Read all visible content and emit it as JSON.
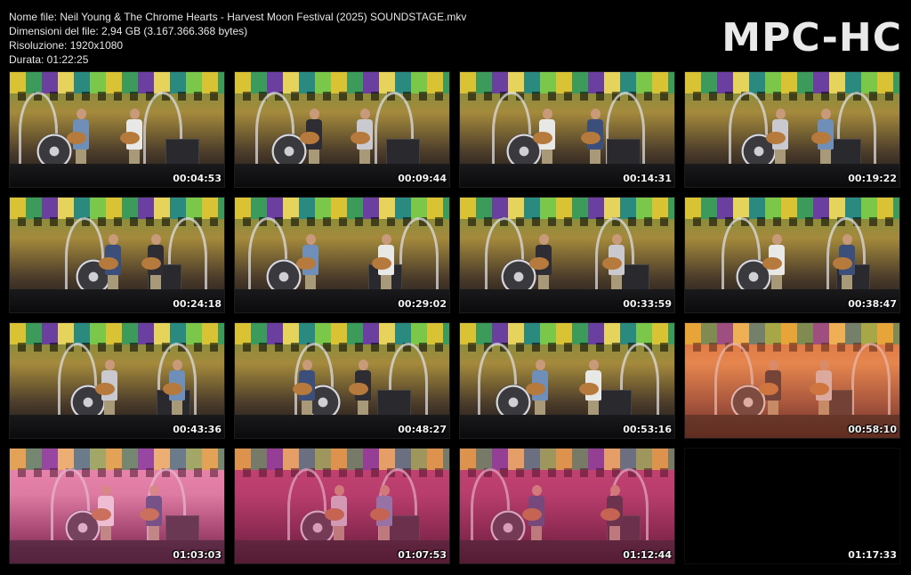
{
  "header": {
    "filename_line": "Nome file: Neil Young & The Chrome Hearts -  Harvest Moon Festival (2025) SOUNDSTAGE.mkv",
    "filesize_line": "Dimensioni del file: 2,94 GB (3.167.366.368 bytes)",
    "resolution_line": "Risoluzione: 1920x1080",
    "duration_line": "Durata: 01:22:25",
    "logo": "MPC-HC"
  },
  "thumbnails": [
    {
      "time": "00:04:53",
      "tone": "daylight"
    },
    {
      "time": "00:09:44",
      "tone": "daylight"
    },
    {
      "time": "00:14:31",
      "tone": "daylight"
    },
    {
      "time": "00:19:22",
      "tone": "daylight"
    },
    {
      "time": "00:24:18",
      "tone": "daylight"
    },
    {
      "time": "00:29:02",
      "tone": "daylight"
    },
    {
      "time": "00:33:59",
      "tone": "daylight"
    },
    {
      "time": "00:38:47",
      "tone": "daylight"
    },
    {
      "time": "00:43:36",
      "tone": "daylight"
    },
    {
      "time": "00:48:27",
      "tone": "daylight"
    },
    {
      "time": "00:53:16",
      "tone": "daylight"
    },
    {
      "time": "00:58:10",
      "tone": "sunset"
    },
    {
      "time": "01:03:03",
      "tone": "pink"
    },
    {
      "time": "01:07:53",
      "tone": "dusk"
    },
    {
      "time": "01:12:44",
      "tone": "dusk"
    },
    {
      "time": "01:17:33",
      "tone": "black"
    }
  ],
  "colors": {
    "background": "#000000",
    "text": "#e6e6e6",
    "logo": "#e9e9e9"
  }
}
